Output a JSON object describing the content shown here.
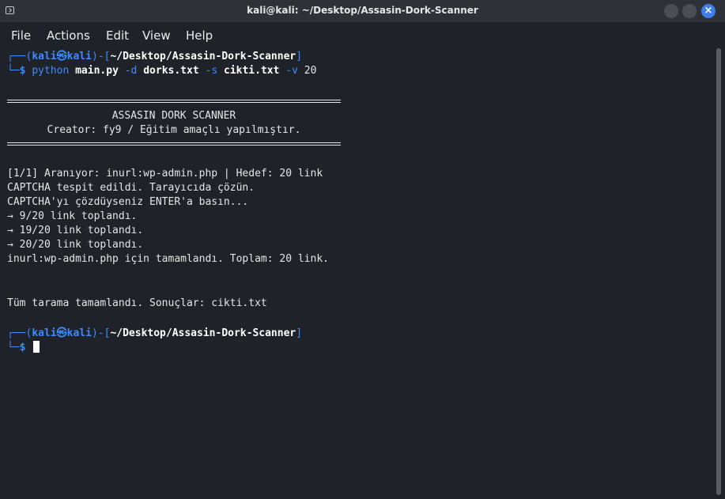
{
  "window": {
    "title": "kali@kali: ~/Desktop/Assasin-Dork-Scanner",
    "close_symbol": "×"
  },
  "menu": [
    "File",
    "Actions",
    "Edit",
    "View",
    "Help"
  ],
  "prompt1": {
    "corner_top": "┌──(",
    "user": "kali",
    "at": "㉿",
    "host": "kali",
    "path_open": ")-[",
    "path": "~/Desktop/Assasin-Dork-Scanner",
    "path_close": "]",
    "corner_bottom": "└─",
    "dollar": "$",
    "cmd": "python",
    "arg_main": "main.py",
    "flag_d": "-d",
    "arg_dorks": "dorks.txt",
    "flag_s": "-s",
    "arg_out": "cikti.txt",
    "flag_v": "-v",
    "num": "20"
  },
  "banner": {
    "title": "ASSASIN DORK SCANNER",
    "creator": "Creator: fy9 / Eğitim amaçlı yapılmıştır."
  },
  "output": [
    "[1/1] Aranıyor: inurl:wp-admin.php | Hedef: 20 link",
    "CAPTCHA tespit edildi. Tarayıcıda çözün.",
    "CAPTCHA'yı çözdüyseniz ENTER'a basın...",
    "→ 9/20 link toplandı.",
    "→ 19/20 link toplandı.",
    "→ 20/20 link toplandı.",
    "inurl:wp-admin.php için tamamlandı. Toplam: 20 link."
  ],
  "final": "Tüm tarama tamamlandı. Sonuçlar: cikti.txt",
  "prompt2": {
    "corner_top": "┌──(",
    "user": "kali",
    "at": "㉿",
    "host": "kali",
    "path_open": ")-[",
    "path": "~/Desktop/Assasin-Dork-Scanner",
    "path_close": "]",
    "corner_bottom": "└─",
    "dollar": "$"
  }
}
